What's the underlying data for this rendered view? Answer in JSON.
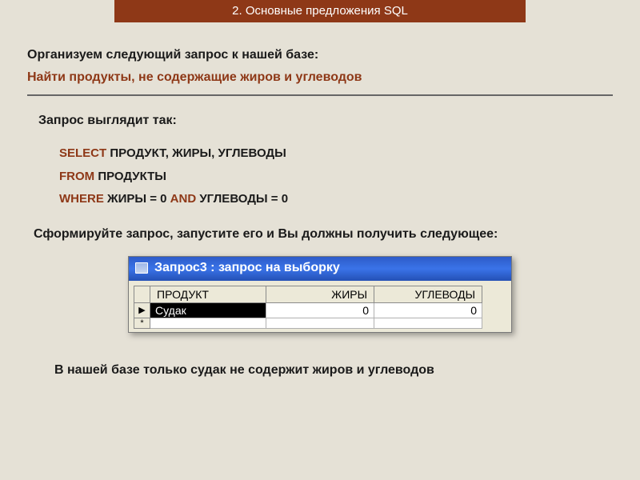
{
  "header": {
    "title": "2. Основные предложения SQL"
  },
  "intro": {
    "line1": "Организуем следующий запрос к нашей базе:",
    "line2": "Найти продукты, не содержащие жиров и углеводов"
  },
  "query_label": "Запрос выглядит так:",
  "sql": {
    "select_kw": "SELECT",
    "select_args": " ПРОДУКТ, ЖИРЫ, УГЛЕВОДЫ",
    "from_kw": "FROM",
    "from_args": " ПРОДУКТЫ",
    "where_kw": "WHERE",
    "where_args1": " ЖИРЫ = 0 ",
    "and_kw": "AND",
    "where_args2": " УГЛЕВОДЫ = 0"
  },
  "instruction": "Сформируйте запрос, запустите его и Вы должны получить следующее:",
  "window": {
    "title": "Запрос3 : запрос на выборку",
    "columns": {
      "c1": "ПРОДУКТ",
      "c2": "ЖИРЫ",
      "c3": "УГЛЕВОДЫ"
    },
    "row1": {
      "marker": "▶",
      "product": "Судак",
      "fat": "0",
      "carb": "0"
    },
    "row2": {
      "marker": "*",
      "product": "",
      "fat": "",
      "carb": ""
    }
  },
  "conclusion": "В нашей базе только судак не содержит жиров и углеводов",
  "chart_data": {
    "type": "table",
    "title": "Запрос3 : запрос на выборку",
    "columns": [
      "ПРОДУКТ",
      "ЖИРЫ",
      "УГЛЕВОДЫ"
    ],
    "rows": [
      {
        "ПРОДУКТ": "Судак",
        "ЖИРЫ": 0,
        "УГЛЕВОДЫ": 0
      }
    ]
  }
}
